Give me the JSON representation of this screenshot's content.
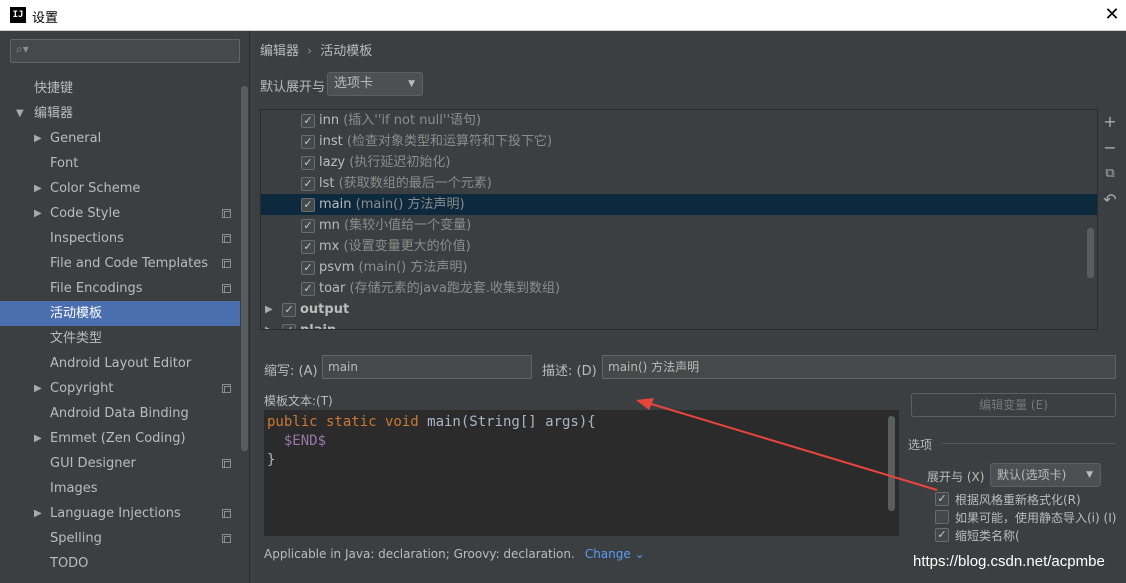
{
  "window": {
    "title": "设置",
    "logo": "IJ"
  },
  "sidebar": {
    "search_placeholder": "",
    "items": [
      {
        "label": "快捷键",
        "level": 1,
        "arrow": "",
        "copy": false,
        "selected": false
      },
      {
        "label": "编辑器",
        "level": 0,
        "arrow": "▼",
        "copy": false,
        "selected": false
      },
      {
        "label": "General",
        "level": 1,
        "arrow": "▶",
        "copy": false,
        "selected": false
      },
      {
        "label": "Font",
        "level": 1,
        "arrow": "",
        "copy": false,
        "selected": false
      },
      {
        "label": "Color Scheme",
        "level": 1,
        "arrow": "▶",
        "copy": false,
        "selected": false
      },
      {
        "label": "Code Style",
        "level": 1,
        "arrow": "▶",
        "copy": true,
        "selected": false
      },
      {
        "label": "Inspections",
        "level": 1,
        "arrow": "",
        "copy": true,
        "selected": false
      },
      {
        "label": "File and Code Templates",
        "level": 1,
        "arrow": "",
        "copy": true,
        "selected": false
      },
      {
        "label": "File Encodings",
        "level": 1,
        "arrow": "",
        "copy": true,
        "selected": false
      },
      {
        "label": "活动模板",
        "level": 1,
        "arrow": "",
        "copy": false,
        "selected": true
      },
      {
        "label": "文件类型",
        "level": 1,
        "arrow": "",
        "copy": false,
        "selected": false
      },
      {
        "label": "Android Layout Editor",
        "level": 1,
        "arrow": "",
        "copy": false,
        "selected": false
      },
      {
        "label": "Copyright",
        "level": 1,
        "arrow": "▶",
        "copy": true,
        "selected": false
      },
      {
        "label": "Android Data Binding",
        "level": 1,
        "arrow": "",
        "copy": false,
        "selected": false
      },
      {
        "label": "Emmet (Zen Coding)",
        "level": 1,
        "arrow": "▶",
        "copy": false,
        "selected": false
      },
      {
        "label": "GUI Designer",
        "level": 1,
        "arrow": "",
        "copy": true,
        "selected": false
      },
      {
        "label": "Images",
        "level": 1,
        "arrow": "",
        "copy": false,
        "selected": false
      },
      {
        "label": "Language Injections",
        "level": 1,
        "arrow": "▶",
        "copy": true,
        "selected": false
      },
      {
        "label": "Spelling",
        "level": 1,
        "arrow": "",
        "copy": true,
        "selected": false
      },
      {
        "label": "TODO",
        "level": 1,
        "arrow": "",
        "copy": false,
        "selected": false
      }
    ]
  },
  "main": {
    "breadcrumb": [
      "编辑器",
      "活动模板"
    ],
    "breadcrumb_sep": "›",
    "expand_label": "默认展开与",
    "expand_value": "选项卡",
    "templates": [
      {
        "abbr": "inn",
        "desc": " (插入''if not null''语句)",
        "checked": true,
        "selected": false
      },
      {
        "abbr": "inst",
        "desc": " (检查对象类型和运算符和下投下它)",
        "checked": true,
        "selected": false
      },
      {
        "abbr": "lazy",
        "desc": " (执行延迟初始化)",
        "checked": true,
        "selected": false
      },
      {
        "abbr": "lst",
        "desc": " (获取数组的最后一个元素)",
        "checked": true,
        "selected": false
      },
      {
        "abbr": "main",
        "desc": " (main() 方法声明)",
        "checked": true,
        "selected": true
      },
      {
        "abbr": "mn",
        "desc": " (集较小值给一个变量)",
        "checked": true,
        "selected": false
      },
      {
        "abbr": "mx",
        "desc": " (设置变量更大的价值)",
        "checked": true,
        "selected": false
      },
      {
        "abbr": "psvm",
        "desc": " (main() 方法声明)",
        "checked": true,
        "selected": false
      },
      {
        "abbr": "toar",
        "desc": " (存储元素的java跑龙套.收集到数组)",
        "checked": true,
        "selected": false
      }
    ],
    "groups": [
      {
        "label": "output",
        "checked": true
      },
      {
        "label": "plain",
        "checked": true
      }
    ],
    "tools": {
      "add": "+",
      "remove": "−",
      "copy": "⧉",
      "revert": "↶"
    },
    "abbr_label": "缩写: (A)",
    "abbr_value": "main",
    "desc_label": "描述: (D)",
    "desc_value": "main() 方法声明",
    "template_text_label": "模板文本:(T)",
    "code": {
      "line1_kw": "public static void",
      "line1_rest": " main(String[] args){",
      "line2_var": "$END$",
      "line3": "}"
    },
    "edit_vars_label": "编辑变量 (E)",
    "options_title": "选项",
    "expand2_label": "展开与 (X)",
    "expand2_value": "默认(选项卡)",
    "options": [
      {
        "label": "根据风格重新格式化(R)",
        "checked": true
      },
      {
        "label": "如果可能，使用静态导入(i) (I)",
        "checked": false
      },
      {
        "label": "缩短类名称(",
        "checked": true
      }
    ],
    "applicable_text": "Applicable in Java: declaration; Groovy: declaration.",
    "change_label": "Change"
  },
  "watermark": "https://blog.csdn.net/acpmbe",
  "colors": {
    "accent": "#4b6eaf",
    "annotation_arrow": "#e8453c"
  }
}
